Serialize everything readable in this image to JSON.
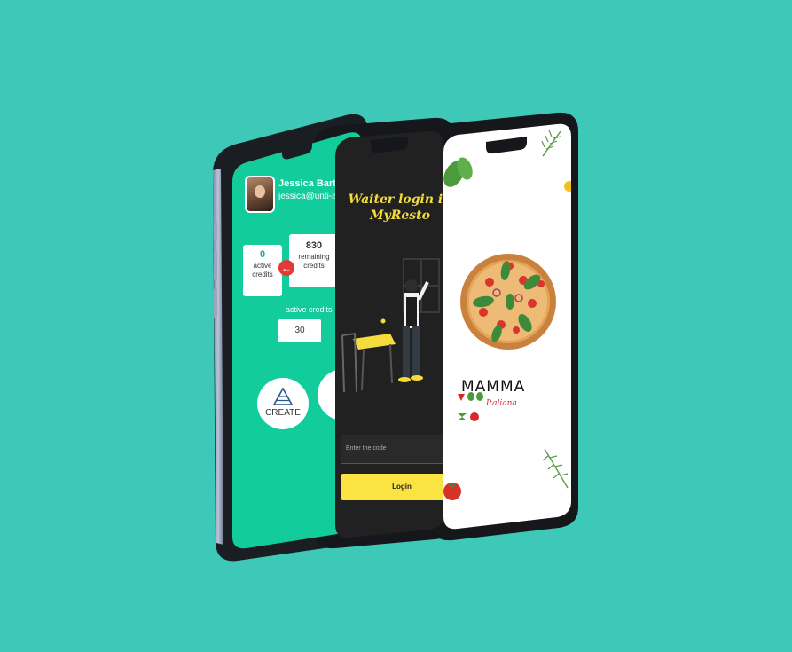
{
  "credits_app": {
    "user_name": "Jessica Barton",
    "user_email": "jessica@unti-ap",
    "active_count": "0",
    "active_label": "active credits",
    "remaining_count": "830",
    "remaining_label": "remaining credits",
    "active_credits_label": "active credits",
    "active_credits_value": "30",
    "create_label": "CREATE"
  },
  "waiter_app": {
    "title": "Waiter login in MyResto",
    "code_placeholder": "Enter the code",
    "login_label": "Login"
  },
  "pizza_app": {
    "brand": "MAMMA",
    "brand_subtitle": "Italiana"
  },
  "colors": {
    "background": "#3ec8b8",
    "credits_green": "#12cc9c",
    "waiter_dark": "#212121",
    "waiter_yellow": "#fbe342",
    "brand_red": "#d6272d"
  }
}
